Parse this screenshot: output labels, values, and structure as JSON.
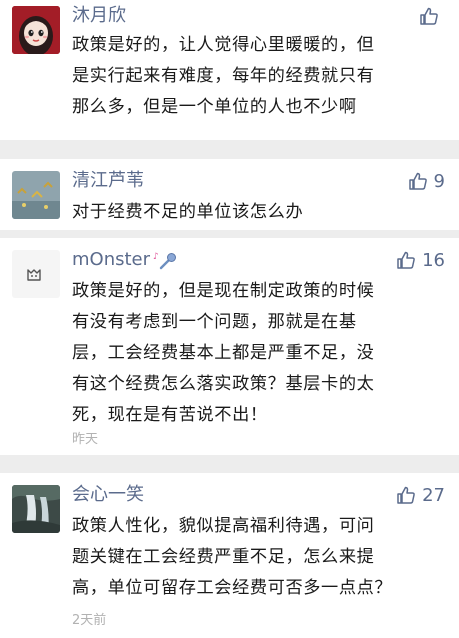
{
  "comments": [
    {
      "name": "沐月欣",
      "likes": "",
      "lines": [
        "政策是好的，让人觉得心里暖暖的，但",
        "是实行起来有难度，每年的经费就只有",
        "那么多，但是一个单位的人也不少啊"
      ],
      "time": "",
      "avatar_icon": "cartoon-girl-avatar"
    },
    {
      "name": "清江芦苇",
      "likes": "9",
      "lines": [
        "对于经费不足的单位该怎么办"
      ],
      "time": "",
      "avatar_icon": "landscape-avatar"
    },
    {
      "name": "mOnster",
      "likes": "16",
      "lines": [
        "政策是好的，但是现在制定政策的时候",
        "有没有考虑到一个问题，那就是在基",
        "层，工会经费基本上都是严重不足，没",
        "有这个经费怎么落实政策？基层卡的太",
        "死，现在是有苦说不出！"
      ],
      "time": "昨天",
      "avatar_icon": "white-cat-avatar"
    },
    {
      "name": "会心一笑",
      "likes": "27",
      "lines": [
        "政策人性化，貌似提高福利待遇，可问",
        "题关键在工会经费严重不足，怎么来提",
        "高，单位可留存工会经费可否多一点点？"
      ],
      "time": "2天前",
      "avatar_icon": "waterfall-avatar"
    }
  ],
  "colors": {
    "name": "#5b6b8c",
    "text": "#1a1a1a",
    "time": "#b2b2b2",
    "background": "#ededed",
    "card": "#ffffff"
  }
}
